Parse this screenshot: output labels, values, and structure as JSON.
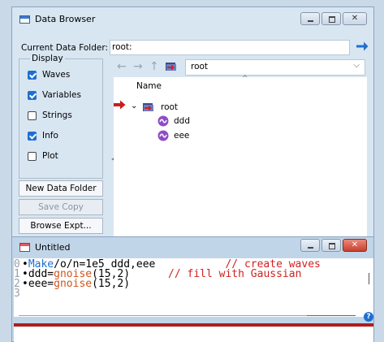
{
  "data_browser": {
    "title": "Data Browser",
    "current_folder_label": "Current Data Folder:",
    "current_folder_value": "root:",
    "display": {
      "legend": "Display",
      "options": [
        {
          "label": "Waves",
          "checked": true
        },
        {
          "label": "Variables",
          "checked": true
        },
        {
          "label": "Strings",
          "checked": false
        },
        {
          "label": "Info",
          "checked": true
        },
        {
          "label": "Plot",
          "checked": false
        }
      ]
    },
    "buttons": {
      "new_folder": "New Data Folder",
      "save_copy": "Save Copy",
      "browse_expt": "Browse Expt..."
    },
    "nav": {
      "back": "←",
      "forward": "→",
      "up": "↑",
      "folder_dropdown": "root",
      "dropdown_chevron": "⌵"
    },
    "tree": {
      "column_header": "Name",
      "root_label": "root",
      "children": [
        "ddd",
        "eee"
      ]
    }
  },
  "editor": {
    "title": "Untitled",
    "lines": [
      {
        "num": "0",
        "parts": [
          {
            "t": "•",
            "c": ""
          },
          {
            "t": "Make",
            "c": "kw"
          },
          {
            "t": "/o/n=1e5 ddd,eee",
            "c": ""
          },
          {
            "t": "           // create waves",
            "c": "cm"
          }
        ]
      },
      {
        "num": "1",
        "parts": [
          {
            "t": "•ddd=",
            "c": ""
          },
          {
            "t": "gnoise",
            "c": "fn"
          },
          {
            "t": "(15,2)",
            "c": ""
          },
          {
            "t": "      // fill with Gaussian",
            "c": "cm"
          }
        ]
      },
      {
        "num": "2",
        "parts": [
          {
            "t": "•eee=",
            "c": ""
          },
          {
            "t": "gnoise",
            "c": "fn"
          },
          {
            "t": "(15,2)",
            "c": ""
          }
        ]
      },
      {
        "num": "3",
        "parts": []
      }
    ],
    "help_icon": "?"
  },
  "colors": {
    "accent": "#1f6fd0",
    "function": "#d1551c",
    "comment": "#d12121",
    "arrow_red": "#c81e1e"
  }
}
